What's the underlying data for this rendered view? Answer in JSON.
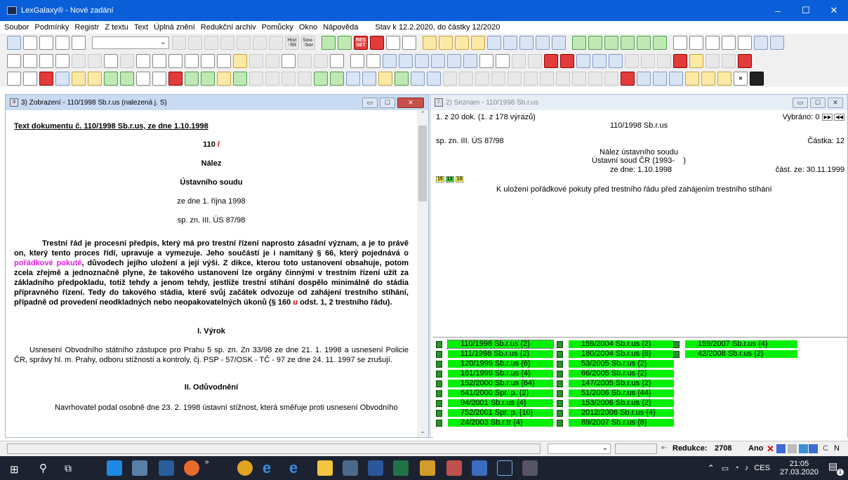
{
  "window": {
    "title": "LexGalaxy® - Nové zadání",
    "min": "–",
    "max": "☐",
    "close": "✕"
  },
  "menu": {
    "items": [
      "Soubor",
      "Podmínky",
      "Registr",
      "Z textu",
      "Text",
      "Úplná znění",
      "Redukční archiv",
      "Pomůcky",
      "Okno",
      "Nápověda"
    ],
    "stav": "Stav k 12.2.2020, do částky 12/2020"
  },
  "toolbar1": [
    "Hist ↑filt",
    "Sou- ↑bor",
    "RES SET"
  ],
  "left_panel": {
    "title": "3) Zobrazení - 110/1998 Sb.r.us (nalezená j. S)",
    "heading": "Text dokumentu č. 110/1998 Sb.r.us, ze dne 1.10.1998",
    "num": "110",
    "num_mark": "/",
    "nalez": "Nález",
    "court": "Ústavního soudu",
    "date": "ze dne 1. října 1998",
    "spzn": "sp. zn. III. ÚS 87/98",
    "para1_a": "Trestní řád je procesní předpis, který má pro trestní řízení naprosto zásadní význam, a je to právě on, který tento proces řídí, upravuje a vymezuje. Jeho součástí je i namítaný § 66, který pojednává o ",
    "para1_hl": "pořádkové pokutě",
    "para1_b": ", důvodech jejího uložení a její výši. Z dikce, kterou toto ustanovení obsahuje, potom zcela zřejmě a jednoznačně plyne, že takového ustanovení lze orgány činnými v trestním řízení užít za základního předpokladu, totiž tehdy a jenom tehdy, jestliže trestní stíhání dospělo minimálně do stádia přípravného řízení. Tedy do takového stádia, které svůj začátek odvozuje od zahájení trestního stíhání, případně od provedení neodkladných nebo neopakovatelných úkonů (§ 160 ",
    "para1_u": "u",
    "para1_c": " odst. 1, 2 trestního řádu).",
    "section1": "I. Výrok",
    "para2": "Usnesení Obvodního státního zástupce pro Prahu 5 sp. zn. Zn 33/98 ze dne 21. 1. 1998 a usnesení Policie ČR, správy hl. m. Prahy, odboru stížností a kontroly, čj. PSP - 57/OSK - TČ - 97 ze dne 24. 11. 1997 se zrušují.",
    "section2": "II. Odůvodnění",
    "para3": "Navrhovatel podal osobně dne 23. 2. 1998 ústavní stížnost, která směřuje proti usnesení Obvodního"
  },
  "right_panel": {
    "title": "2) Seznam - 110/1998 Sb.r.us",
    "count": "1. z 20 dok. (1. z 178 výrazů)",
    "vybrano": "Vybráno: 0",
    "doc_id": "110/1998 Sb.r.us",
    "spzn": "sp. zn. III. ÚS 87/98",
    "castka": "Částka: 12",
    "type": "Nález ústavního soudu",
    "court": "Ústavní soud ČR (1993-    )",
    "date": "ze dne: 1.10.1998",
    "cast_date": "část. ze: 30.11.1999",
    "tags": [
      "15",
      "13",
      "10"
    ],
    "subject": "K uložení pořádkové pokuty před trestního řádu před zahájením trestního stíhání",
    "list": [
      [
        "110/1998 Sb.r.us {2}",
        "111/1998 Sb.r.us {2}",
        "120/1999 Sb.r.us {6}",
        "161/1999 Sb.r.us {4}",
        "152/2000 Sb.r.us {64}",
        "641/2000 Spr. p. {2}",
        "94/2001 Sb.r.us {4}",
        "752/2001 Spr. p. {10}",
        "24/2003 Sb.r.tr {4}"
      ],
      [
        "159/2004 Sb.r.us {2}",
        "180/2004 Sb.r.us {8}",
        "53/2005 Sb.r.us {2}",
        "66/2005 Sb.r.us {2}",
        "147/2005 Sb.r.us {2}",
        "51/2006 Sb.r.us {44}",
        "153/2006 Sb.r.us {2}",
        "2012/2006 Sb.r.us {4}",
        "89/2007 Sb.r.us {8}"
      ],
      [
        "159/2007 Sb.r.us {4}",
        "42/2008 Sb.r.us {2}"
      ]
    ]
  },
  "status": {
    "redukce_label": "Redukce:",
    "redukce_value": "2708",
    "ano": "Ano",
    "c": "C",
    "n": "N"
  },
  "taskbar": {
    "lang": "CES",
    "time": "21:05",
    "date": "27.03.2020",
    "notif": "1"
  }
}
